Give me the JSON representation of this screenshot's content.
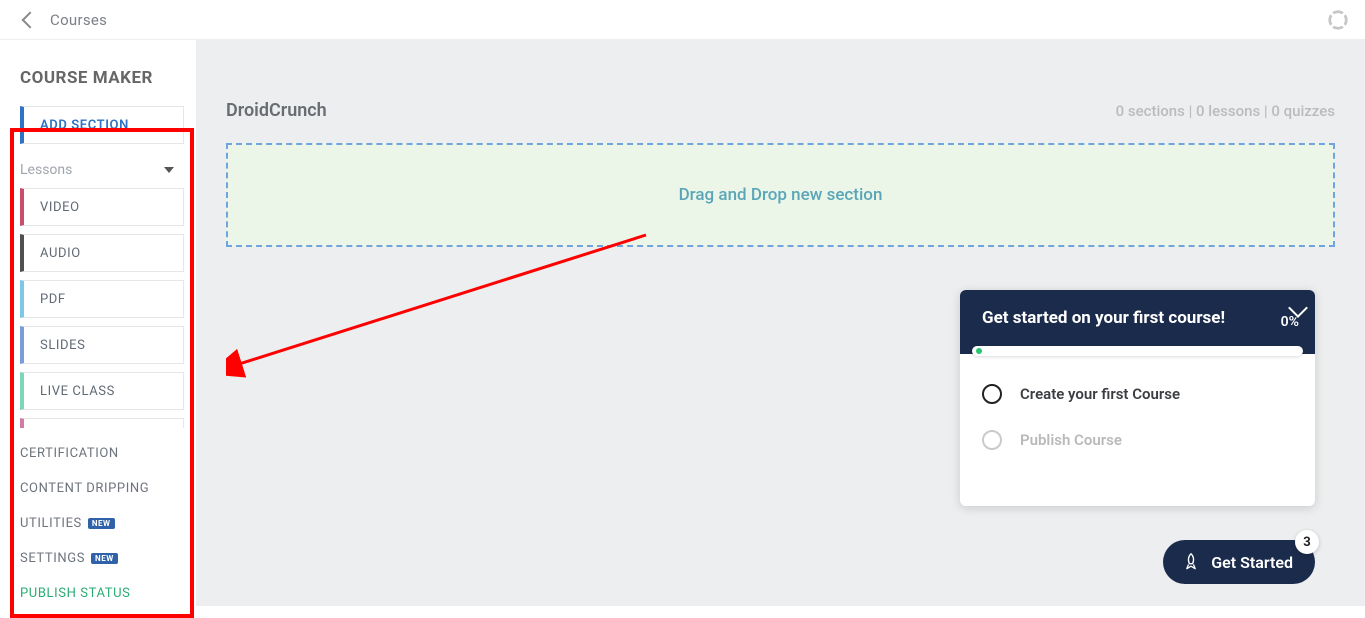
{
  "header": {
    "back_label": "Courses"
  },
  "sidebar": {
    "title": "COURSE MAKER",
    "add_section_label": "ADD SECTION",
    "lessons_label": "Lessons",
    "items": {
      "video": "VIDEO",
      "audio": "AUDIO",
      "pdf": "PDF",
      "slides": "SLIDES",
      "live_class": "LIVE CLASS"
    },
    "nav": {
      "certification": "CERTIFICATION",
      "content_dripping": "CONTENT DRIPPING",
      "utilities": "UTILITIES",
      "settings": "SETTINGS",
      "publish_status": "PUBLISH STATUS",
      "new_badge": "NEW"
    }
  },
  "main": {
    "course_title": "DroidCrunch",
    "stats": "0 sections | 0 lessons | 0 quizzes",
    "dropzone_text": "Drag and Drop new section"
  },
  "onboarding": {
    "title": "Get started on your first course!",
    "percent": "0%",
    "tasks": {
      "create": "Create your first Course",
      "publish": "Publish Course"
    }
  },
  "get_started": {
    "label": "Get Started",
    "count": "3"
  }
}
